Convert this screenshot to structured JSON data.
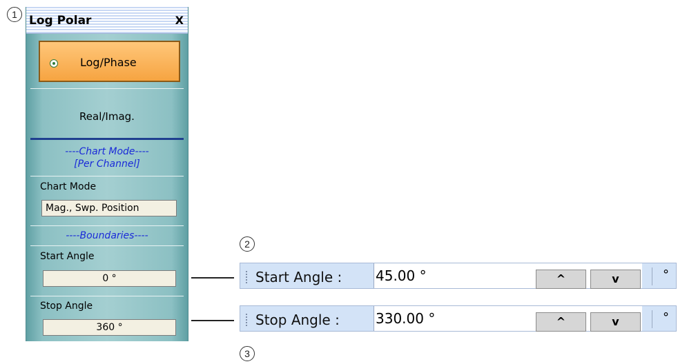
{
  "callouts": [
    "1",
    "2",
    "3"
  ],
  "panel": {
    "title": "Log Polar",
    "close_label": "X",
    "logphase_label": "Log/Phase",
    "realimag_label": "Real/Imag.",
    "chart_mode_section_line1": "----Chart Mode----",
    "chart_mode_section_line2": "[Per Channel]",
    "chart_mode_label": "Chart Mode",
    "chart_mode_value": "Mag., Swp. Position",
    "boundaries_section": "----Boundaries----",
    "start_angle_label": "Start Angle",
    "start_angle_value": "0 °",
    "stop_angle_label": "Stop Angle",
    "stop_angle_value": "360 °"
  },
  "start_bar": {
    "label": "Start Angle :",
    "value": "45.00 °",
    "up": "^",
    "down": "v",
    "unit": "°"
  },
  "stop_bar": {
    "label": "Stop Angle :",
    "value": "330.00 °",
    "up": "^",
    "down": "v",
    "unit": "°"
  }
}
